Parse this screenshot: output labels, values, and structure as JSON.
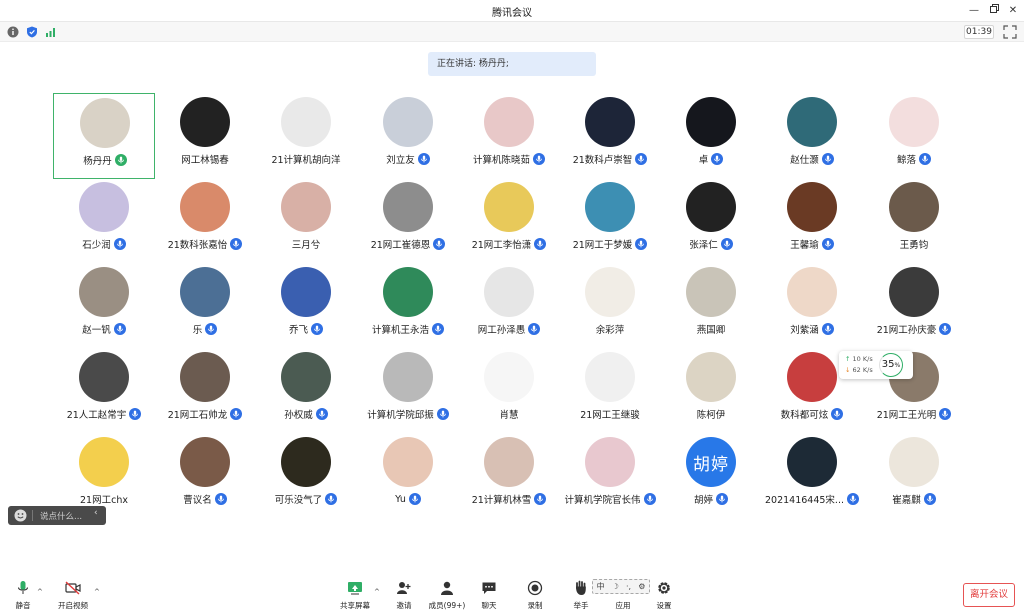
{
  "window": {
    "title": "腾讯会议"
  },
  "status": {
    "timer": "01:39"
  },
  "speaking": {
    "label": "正在讲话: 杨丹丹;"
  },
  "participants": [
    {
      "name": "杨丹丹",
      "mic": "green",
      "active": true,
      "color": "#d9d2c6"
    },
    {
      "name": "网工林锡春",
      "mic": "none",
      "color": "#222222"
    },
    {
      "name": "21计算机胡向洋",
      "mic": "none",
      "color": "#e9e9e9"
    },
    {
      "name": "刘立友",
      "mic": "blue",
      "color": "#c9cfd9"
    },
    {
      "name": "计算机陈晓茹",
      "mic": "blue",
      "color": "#e8c8c8"
    },
    {
      "name": "21数科卢崇智",
      "mic": "blue",
      "color": "#1d2538"
    },
    {
      "name": "卓",
      "mic": "blue",
      "color": "#15171d"
    },
    {
      "name": "赵仕灏",
      "mic": "blue",
      "color": "#2f6a78"
    },
    {
      "name": "鲸落",
      "mic": "blue",
      "color": "#f3dede"
    },
    {
      "name": "石少润",
      "mic": "blue",
      "color": "#c7bfe0"
    },
    {
      "name": "21数科张嘉怡",
      "mic": "blue",
      "color": "#d98a6a"
    },
    {
      "name": "三月兮",
      "mic": "none",
      "color": "#d8b0a6"
    },
    {
      "name": "21网工崔德恩",
      "mic": "blue",
      "color": "#8d8d8d"
    },
    {
      "name": "21网工李怡潇",
      "mic": "blue",
      "color": "#e8c95a"
    },
    {
      "name": "21网工于梦媛",
      "mic": "blue",
      "color": "#3d8fb3"
    },
    {
      "name": "张泽仁",
      "mic": "blue",
      "color": "#222222"
    },
    {
      "name": "王馨瑜",
      "mic": "blue",
      "color": "#6a3a24"
    },
    {
      "name": "王勇钧",
      "mic": "none",
      "color": "#6b5a4b"
    },
    {
      "name": "赵一钒",
      "mic": "blue",
      "color": "#9a8f83"
    },
    {
      "name": "乐",
      "mic": "blue",
      "color": "#4c6f95"
    },
    {
      "name": "乔飞",
      "mic": "blue",
      "color": "#3a5fb0"
    },
    {
      "name": "计算机王永浩",
      "mic": "blue",
      "color": "#2f8a5a"
    },
    {
      "name": "网工孙泽愚",
      "mic": "blue",
      "color": "#e6e6e6"
    },
    {
      "name": "余彩萍",
      "mic": "none",
      "color": "#f1ede6"
    },
    {
      "name": "燕国卿",
      "mic": "none",
      "color": "#c9c4b8"
    },
    {
      "name": "刘紫涵",
      "mic": "blue",
      "color": "#eed8c8"
    },
    {
      "name": "21网工孙庆豪",
      "mic": "blue",
      "color": "#3b3b3b"
    },
    {
      "name": "21人工赵常宇",
      "mic": "blue",
      "color": "#4a4a4a"
    },
    {
      "name": "21网工石帅龙",
      "mic": "blue",
      "color": "#6b5b50"
    },
    {
      "name": "孙权威",
      "mic": "blue",
      "color": "#4b5b52"
    },
    {
      "name": "计算机学院邱振",
      "mic": "blue",
      "color": "#b9b9b9"
    },
    {
      "name": "肖慧",
      "mic": "none",
      "color": "#f6f6f6"
    },
    {
      "name": "21网工王继骏",
      "mic": "none",
      "color": "#f0f0f0"
    },
    {
      "name": "陈柯伊",
      "mic": "none",
      "color": "#dcd4c4"
    },
    {
      "name": "数科都可炫",
      "mic": "blue",
      "color": "#c73e3e"
    },
    {
      "name": "21网工王光明",
      "mic": "blue",
      "color": "#8a7a6a"
    },
    {
      "name": "21网工chx",
      "mic": "none",
      "color": "#f3cf4d"
    },
    {
      "name": "曹议名",
      "mic": "blue",
      "color": "#7a5a48"
    },
    {
      "name": "可乐没气了",
      "mic": "blue",
      "color": "#2d2a1e"
    },
    {
      "name": "Yu",
      "mic": "blue",
      "color": "#e8c7b5"
    },
    {
      "name": "21计算机林雪",
      "mic": "blue",
      "color": "#d8c0b4"
    },
    {
      "name": "计算机学院官长伟",
      "mic": "blue",
      "color": "#e8c8cf"
    },
    {
      "name": "胡婷",
      "mic": "blue",
      "color": "#2878e8",
      "initials": "胡婷"
    },
    {
      "name": "2021416445宋...",
      "mic": "blue",
      "color": "#1d2a36"
    },
    {
      "name": "崔嘉麒",
      "mic": "blue",
      "color": "#ece6dc"
    }
  ],
  "network": {
    "up": "10 K/s",
    "down": "62 K/s",
    "percent": "35",
    "unit": "%"
  },
  "chat": {
    "placeholder": "说点什么..."
  },
  "toolbar": {
    "mute": "静音",
    "video": "开启视频",
    "share": "共享屏幕",
    "invite": "邀请",
    "members": "成员(99+)",
    "chat": "聊天",
    "record": "录制",
    "raise": "举手",
    "apps": "应用",
    "settings": "设置",
    "leave": "离开会议"
  },
  "ime": {
    "lang": "中",
    "moon": "☽",
    "dot": "·,",
    "mode": "⚙"
  }
}
